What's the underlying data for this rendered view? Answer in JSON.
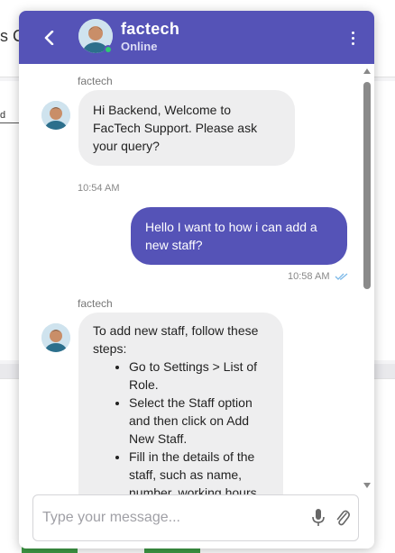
{
  "background": {
    "title_fragment": "s Cl",
    "field_fragment": "d"
  },
  "chat": {
    "agent_name": "factech",
    "agent_status": "Online",
    "messages": [
      {
        "from": "agent",
        "sender": "factech",
        "text": "Hi Backend, Welcome to FacTech Support. Please ask your query?",
        "time": "10:54 AM"
      },
      {
        "from": "user",
        "text": "Hello I want to how i can add a new staff?",
        "time": "10:58 AM",
        "read_icon": "double-check-icon"
      },
      {
        "from": "agent",
        "sender": "factech",
        "intro": "To add new staff, follow these steps:",
        "steps": [
          "Go to Settings > List of Role.",
          "Select the Staff option and then click on Add New Staff.",
          "Fill in the details of the staff, such as name, number, working hours,"
        ]
      }
    ],
    "composer": {
      "placeholder": "Type your message...",
      "mic_icon": "microphone-icon",
      "attach_icon": "paperclip-icon"
    }
  },
  "colors": {
    "brand": "#5553b7",
    "incoming_bubble": "#eeeeef",
    "online": "#2ecc71",
    "read_check": "#7ab8e8"
  }
}
